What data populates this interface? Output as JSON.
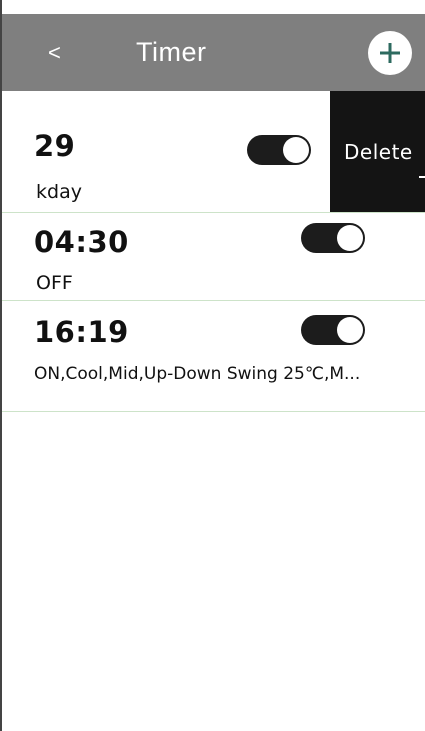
{
  "header": {
    "back_label": "<",
    "title": "Timer",
    "add_icon": "plus-icon"
  },
  "timers": [
    {
      "time": "29",
      "detail": "kday",
      "enabled": true
    },
    {
      "time": "04:30",
      "detail": "OFF",
      "enabled": true
    },
    {
      "time": "16:19",
      "detail": "ON,Cool,Mid,Up-Down Swing 25℃,M...",
      "enabled": true
    }
  ],
  "swipe_action": {
    "label": "Delete"
  },
  "colors": {
    "header_bg": "#7f7f7f",
    "accent_plus": "#2d6a5f",
    "toggle_on": "#1c1c1c",
    "delete_bg": "#141414",
    "divider": "#cde3c9"
  }
}
